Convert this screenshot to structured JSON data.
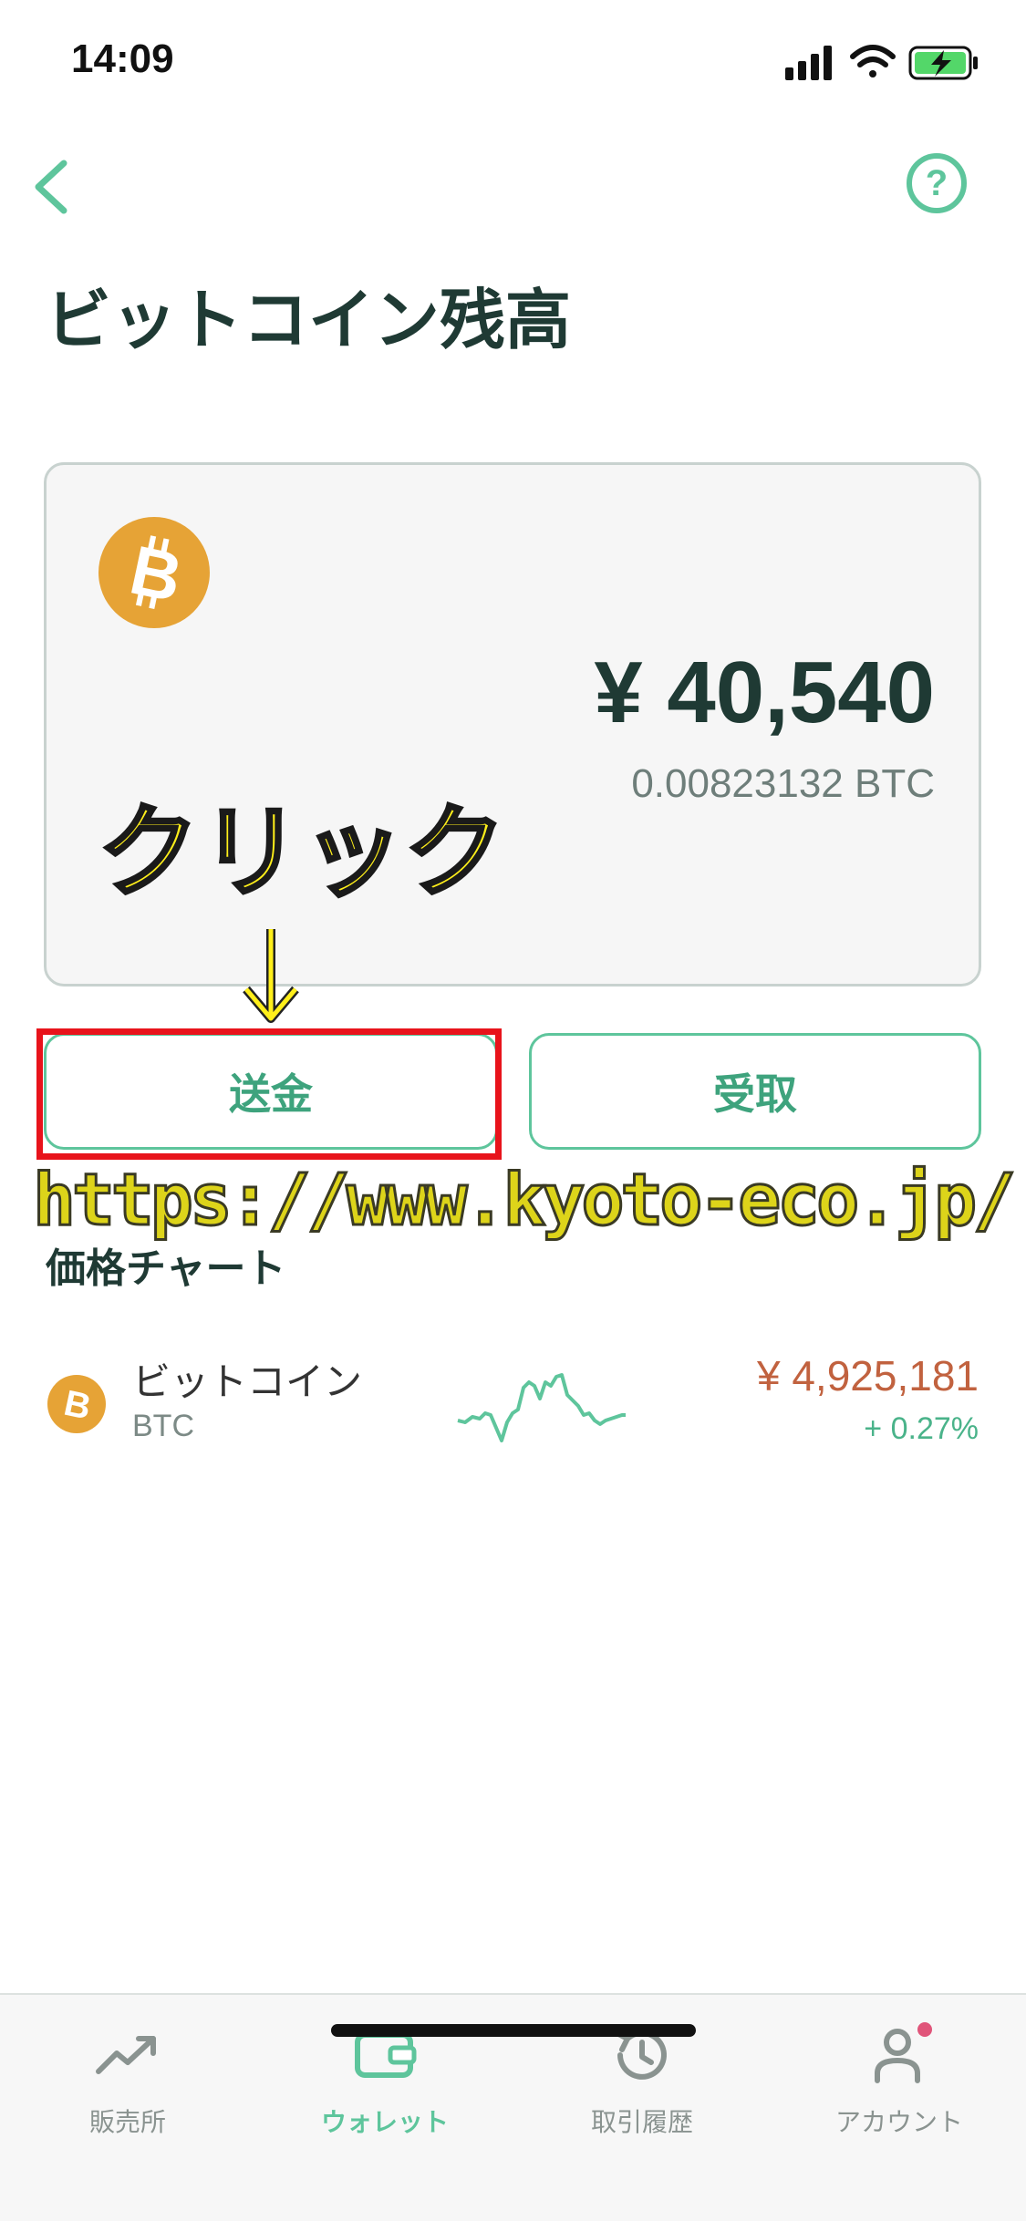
{
  "status_bar": {
    "time": "14:09"
  },
  "header": {
    "back_icon": "chevron-left-icon",
    "help_icon": "question-circle-icon",
    "help_glyph": "?"
  },
  "page": {
    "title": "ビットコイン残高"
  },
  "balance": {
    "jpy": "¥ 40,540",
    "btc": "0.00823132 BTC",
    "coin_icon": "bitcoin-icon"
  },
  "annotation": {
    "click_text": "クリック",
    "arrow_icon": "down-arrow-icon",
    "watermark": "https://www.kyoto-eco.jp/"
  },
  "actions": {
    "send_label": "送金",
    "receive_label": "受取"
  },
  "price_chart": {
    "section_title": "価格チャート",
    "coins": [
      {
        "name": "ビットコイン",
        "symbol": "BTC",
        "price": "¥ 4,925,181",
        "change": "+ 0.27%"
      }
    ]
  },
  "tab_bar": {
    "tabs": [
      {
        "label": "販売所",
        "icon": "trend-up-icon",
        "active": false
      },
      {
        "label": "ウォレット",
        "icon": "wallet-icon",
        "active": true
      },
      {
        "label": "取引履歴",
        "icon": "history-icon",
        "active": false
      },
      {
        "label": "アカウント",
        "icon": "person-icon",
        "active": false
      }
    ]
  },
  "colors": {
    "accent": "#5ec59c",
    "text": "#1f3a34",
    "price": "#c1623f",
    "bitcoin": "#e6a336",
    "highlight": "#e8131b"
  }
}
